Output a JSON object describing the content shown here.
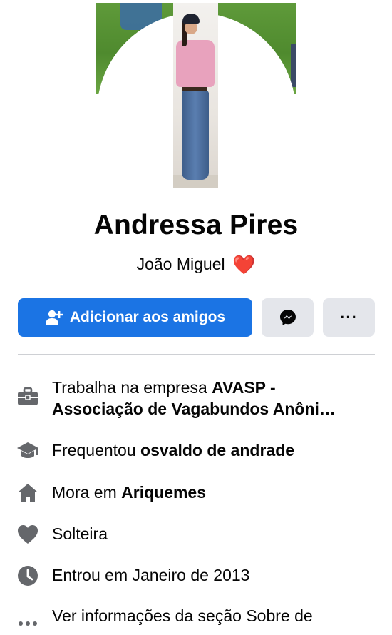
{
  "profile": {
    "name": "Andressa Pires",
    "bio_text": "João Miguel",
    "bio_emoji": "❤️"
  },
  "actions": {
    "add_friend_label": "Adicionar aos amigos",
    "messenger_icon": "messenger-icon",
    "more_label": "···"
  },
  "details": {
    "work_prefix": "Trabalha na empresa ",
    "work_name": "AVASP -",
    "work_line2": "Associação de Vagabundos Anôni…",
    "education_prefix": "Frequentou ",
    "education_name": "osvaldo de andrade",
    "lives_prefix": "Mora em ",
    "lives_name": "Ariquemes",
    "relationship": "Solteira",
    "joined": "Entrou em Janeiro de 2013",
    "see_about": "Ver informações da seção Sobre de"
  },
  "colors": {
    "primary_button": "#1b74e4",
    "secondary_button": "#e4e6eb",
    "icon_gray": "#65676b",
    "heart": "#e0232c"
  }
}
